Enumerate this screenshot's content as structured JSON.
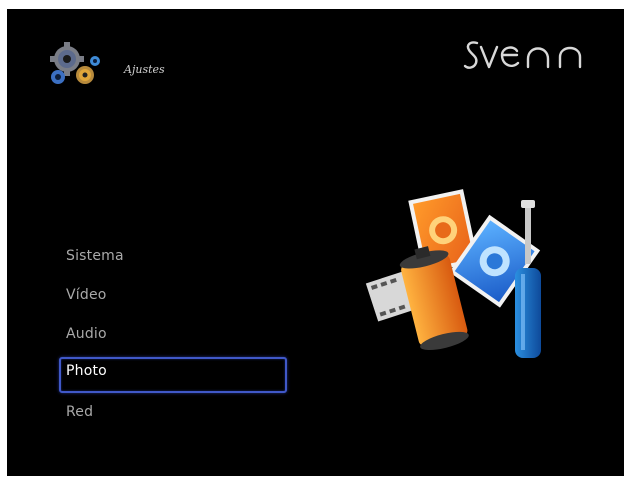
{
  "header": {
    "title": "Ajustes",
    "icon": "gears-settings-icon"
  },
  "brand": {
    "name": "sveon"
  },
  "menu": {
    "items": [
      {
        "label": "Sistema"
      },
      {
        "label": "Vídeo"
      },
      {
        "label": "Audio"
      },
      {
        "label": "Photo"
      },
      {
        "label": "Red"
      }
    ],
    "selected_index": 3
  },
  "illustration": {
    "icon": "photo-settings-icon"
  },
  "colors": {
    "background": "#000000",
    "selection_border": "#4058c8",
    "text_normal": "#a9a9a9",
    "text_selected": "#ffffff"
  }
}
